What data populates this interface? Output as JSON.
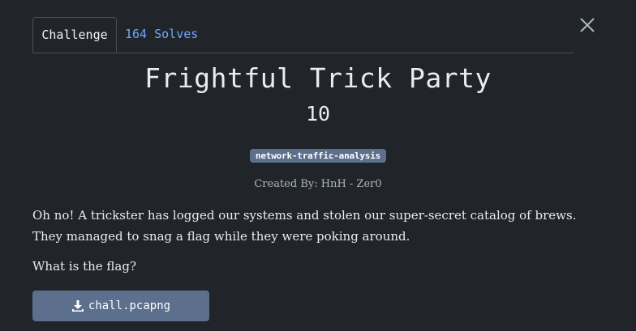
{
  "tabs": {
    "challenge_label": "Challenge",
    "solves_label": "164 Solves"
  },
  "close": {
    "icon": "close-icon"
  },
  "challenge": {
    "title": "Frightful Trick Party",
    "points": "10",
    "tag": "network-traffic-analysis",
    "author": "Created By: HnH - Zer0",
    "description": "Oh no! A trickster has logged our systems and stolen our super-secret catalog of brews. They managed to snag a flag while they were poking around.",
    "question": "What is the flag?"
  },
  "file": {
    "icon": "download-icon",
    "name": "chall.pcapng"
  },
  "colors": {
    "background": "#212529",
    "accent_link": "#6ea8fe",
    "badge": "#5c6f8d"
  }
}
